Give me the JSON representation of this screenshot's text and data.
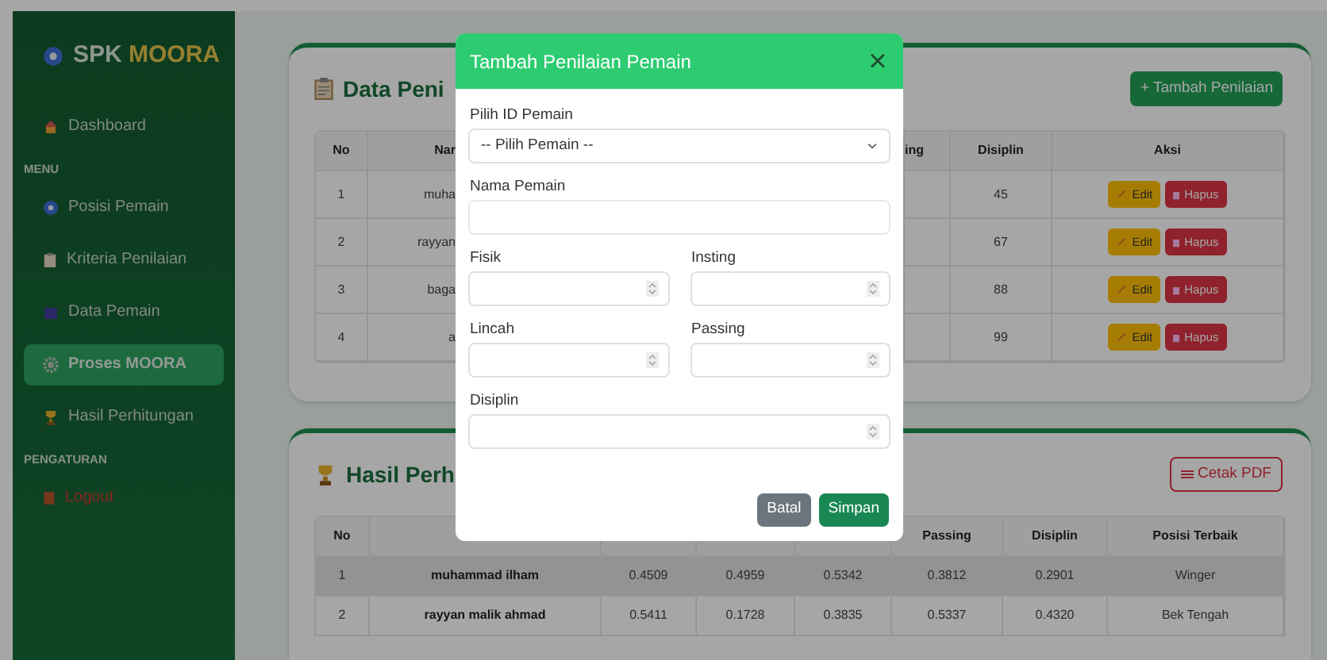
{
  "sidebar": {
    "brand": {
      "first": "SPK",
      "second": "MOORA"
    },
    "items": [
      {
        "kind": "link",
        "label": "Dashboard",
        "selected": false
      },
      {
        "kind": "heading",
        "label": "MENU"
      },
      {
        "kind": "link",
        "label": "Posisi Pemain",
        "selected": false
      },
      {
        "kind": "link",
        "label": "Kriteria Penilaian",
        "selected": false
      },
      {
        "kind": "link",
        "label": "Data Pemain",
        "selected": false
      },
      {
        "kind": "link",
        "label": "Proses MOORA",
        "selected": true
      },
      {
        "kind": "link",
        "label": "Hasil Perhitungan",
        "selected": false
      },
      {
        "kind": "heading",
        "label": "PENGATURAN"
      },
      {
        "kind": "logout",
        "label": "Logout",
        "selected": false
      }
    ]
  },
  "assessment_card": {
    "title": "Data Peni",
    "add_button": "+ Tambah Penilaian",
    "columns": [
      "No",
      "Nar",
      "ing",
      "Disiplin",
      "Aksi"
    ],
    "rows": [
      {
        "no": "1",
        "name": "muha",
        "disiplin": "45",
        "edit": "Edit",
        "delete": "Hapus"
      },
      {
        "no": "2",
        "name": "rayyan",
        "disiplin": "67",
        "edit": "Edit",
        "delete": "Hapus"
      },
      {
        "no": "3",
        "name": "baga",
        "disiplin": "88",
        "edit": "Edit",
        "delete": "Hapus"
      },
      {
        "no": "4",
        "name": "a",
        "disiplin": "99",
        "edit": "Edit",
        "delete": "Hapus"
      }
    ]
  },
  "result_card": {
    "title": "Hasil Perh",
    "print_button": "Cetak PDF",
    "columns": [
      "No",
      "",
      "",
      "",
      "",
      "Passing",
      "Disiplin",
      "Posisi Terbaik"
    ],
    "rows": [
      [
        "1",
        "muhammad ilham",
        "0.4509",
        "0.4959",
        "0.5342",
        "0.3812",
        "0.2901",
        "Winger"
      ],
      [
        "2",
        "rayyan malik ahmad",
        "0.5411",
        "0.1728",
        "0.3835",
        "0.5337",
        "0.4320",
        "Bek Tengah"
      ]
    ]
  },
  "modal": {
    "title": "Tambah Penilaian Pemain",
    "close": "×",
    "rows": [
      [
        {
          "kind": "select",
          "label": "Pilih ID Pemain",
          "value": "-- Pilih Pemain --"
        }
      ],
      [
        {
          "kind": "text",
          "label": "Nama Pemain"
        }
      ],
      [
        {
          "kind": "number",
          "label": "Fisik"
        },
        {
          "kind": "number",
          "label": "Insting"
        }
      ],
      [
        {
          "kind": "number",
          "label": "Lincah"
        },
        {
          "kind": "number",
          "label": "Passing"
        }
      ],
      [
        {
          "kind": "number",
          "label": "Disiplin"
        }
      ]
    ],
    "buttons": [
      {
        "kind": "secondary",
        "label": "Batal"
      },
      {
        "kind": "primary",
        "label": "Simpan"
      }
    ]
  }
}
